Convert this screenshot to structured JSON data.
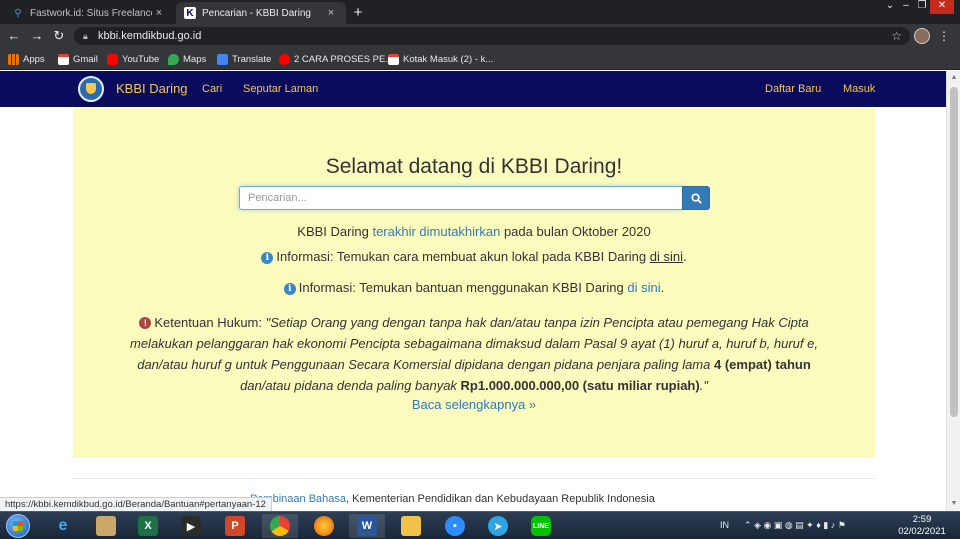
{
  "browser": {
    "tabs": [
      {
        "title": "Fastwork.id: Situs Freelance Online",
        "favicon": "fastwork-icon",
        "active": false
      },
      {
        "title": "Pencarian - KBBI Daring",
        "favicon": "kbbi-k-icon",
        "active": true
      }
    ],
    "new_tab": "+",
    "close_glyph": "×",
    "url": "kbbi.kemdikbud.go.id",
    "bookmarks": [
      "Apps",
      "Gmail",
      "YouTube",
      "Maps",
      "Translate",
      "2 CARA PROSES PE...",
      "Kotak Masuk (2) - k..."
    ]
  },
  "navbar": {
    "brand": "KBBI Daring",
    "left_links": [
      "Cari",
      "Seputar Laman"
    ],
    "right_links": [
      "Daftar Baru",
      "Masuk"
    ]
  },
  "main": {
    "headline": "Selamat datang di KBBI Daring!",
    "search_placeholder": "Pencarian...",
    "update": {
      "pre": "KBBI Daring ",
      "link": "terakhir dimutakhirkan",
      "post": " pada bulan Oktober 2020"
    },
    "info1": {
      "text": "Informasi: Temukan cara membuat akun lokal pada KBBI Daring ",
      "link": "di sini",
      "end": "."
    },
    "info2": {
      "text": "Informasi: Temukan bantuan menggunakan KBBI Daring ",
      "link": "di sini",
      "end": "."
    },
    "legal": {
      "label": "Ketentuan Hukum: ",
      "quote_start": "\"Setiap Orang yang dengan tanpa hak dan/atau tanpa izin Pencipta atau pemegang Hak Cipta melakukan pelanggaran hak ekonomi Pencipta sebagaimana dimaksud dalam Pasal 9 ayat (1) huruf a, huruf b, huruf e, dan/atau huruf g untuk Penggunaan Secara Komersial dipidana dengan pidana penjara paling lama ",
      "bold1": "4 (empat) tahun",
      "middle": " dan/atau pidana denda paling banyak ",
      "bold2": "Rp1.000.000.000,00 (satu miliar rupiah)",
      "quote_end": ".\""
    },
    "read_more": "Baca selengkapnya »"
  },
  "footer": {
    "link": "Pembinaan Bahasa",
    "text": ", Kementerian Pendidikan dan Kebudayaan Republik Indonesia"
  },
  "status_url": "https://kbbi.kemdikbud.go.id/Beranda/Bantuan#pertanyaan-12",
  "taskbar": {
    "apps": [
      "ie-icon",
      "paint-icon",
      "excel-icon",
      "media-player-icon",
      "powerpoint-icon",
      "chrome-icon",
      "firefox-icon",
      "word-icon",
      "explorer-icon",
      "zoom-icon",
      "telegram-icon",
      "line-icon"
    ],
    "lang": "IN",
    "time": "2:59",
    "date": "02/02/2021"
  },
  "colors": {
    "navbar": "#0b0b5e",
    "brand": "#f2c94c",
    "jumbotron": "#fbfbbe",
    "link": "#337ab7"
  }
}
